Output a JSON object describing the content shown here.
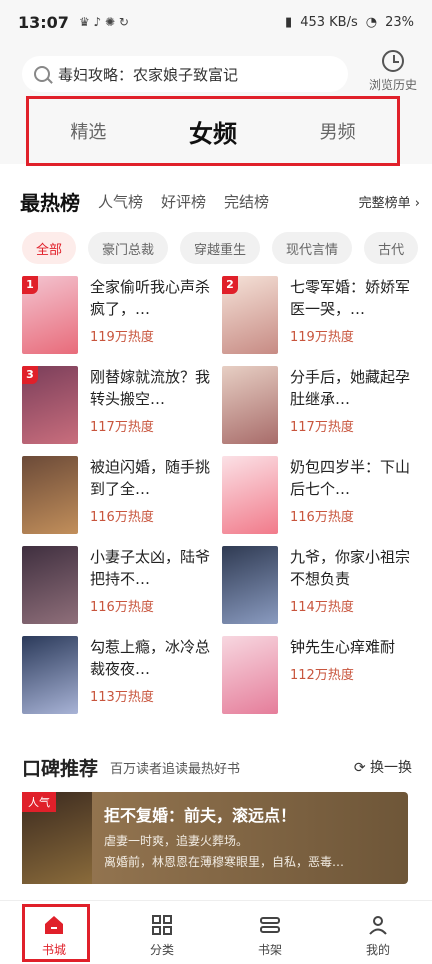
{
  "status_bar": {
    "time": "13:07",
    "network": "453 KB/s",
    "battery": "23%"
  },
  "search": {
    "placeholder": "毒妇攻略：农家娘子致富记"
  },
  "history": {
    "label": "浏览历史"
  },
  "tabs": [
    {
      "label": "精选"
    },
    {
      "label": "女频"
    },
    {
      "label": "男频"
    }
  ],
  "hot": {
    "title": "最热榜",
    "rank_tabs": [
      "人气榜",
      "好评榜",
      "完结榜"
    ],
    "more": "完整榜单"
  },
  "chips": [
    "全部",
    "豪门总裁",
    "穿越重生",
    "现代言情",
    "古代"
  ],
  "books": [
    {
      "rank": "1",
      "title": "全家偷听我心声杀疯了，…",
      "heat": "119万热度"
    },
    {
      "rank": "2",
      "title": "七零军婚：娇娇军医一哭，…",
      "heat": "119万热度"
    },
    {
      "rank": "3",
      "title": "刚替嫁就流放？我转头搬空…",
      "heat": "117万热度"
    },
    {
      "rank": "",
      "title": "分手后，她藏起孕肚继承…",
      "heat": "117万热度"
    },
    {
      "rank": "",
      "title": "被迫闪婚，随手挑到了全…",
      "heat": "116万热度"
    },
    {
      "rank": "",
      "title": "奶包四岁半：下山后七个…",
      "heat": "116万热度"
    },
    {
      "rank": "",
      "title": "小妻子太凶，陆爷把持不…",
      "heat": "116万热度"
    },
    {
      "rank": "",
      "title": "九爷，你家小祖宗不想负责",
      "heat": "114万热度"
    },
    {
      "rank": "",
      "title": "勾惹上瘾，冰冷总裁夜夜…",
      "heat": "113万热度"
    },
    {
      "rank": "",
      "title": "钟先生心痒难耐",
      "heat": "112万热度"
    }
  ],
  "reco": {
    "title": "口碑推荐",
    "subtitle": "百万读者追读最热好书",
    "swap": "换一换",
    "badge": "人气",
    "book_title": "拒不复婚：前夫，滚远点！",
    "line1": "虐妻一时爽，追妻火葬场。",
    "line2": "离婚前，林恩恩在薄穆寒眼里，自私，恶毒…"
  },
  "nav": [
    {
      "label": "书城"
    },
    {
      "label": "分类"
    },
    {
      "label": "书架"
    },
    {
      "label": "我的"
    }
  ]
}
